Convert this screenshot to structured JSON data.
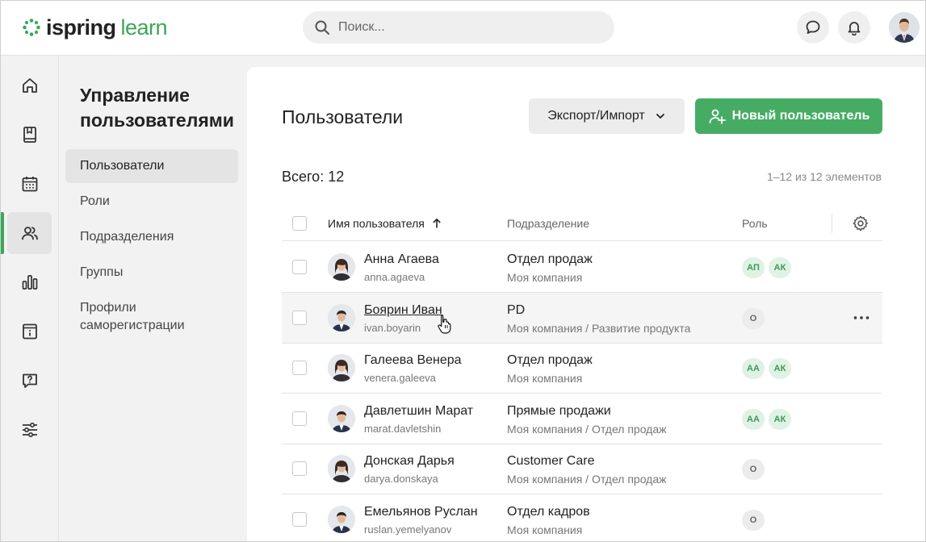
{
  "header": {
    "logo_part1": "ispring",
    "logo_part2": "learn",
    "search_placeholder": "Поиск...",
    "brand_color": "#3aa757"
  },
  "rail": {
    "items": [
      {
        "icon": "home-icon"
      },
      {
        "icon": "book-icon"
      },
      {
        "icon": "calendar-icon"
      },
      {
        "icon": "users-icon",
        "active": true
      },
      {
        "icon": "bar-chart-icon"
      },
      {
        "icon": "info-page-icon"
      },
      {
        "icon": "question-chat-icon"
      },
      {
        "icon": "sliders-icon"
      }
    ]
  },
  "sidebar": {
    "title": "Управление пользователями",
    "items": [
      {
        "label": "Пользователи",
        "active": true
      },
      {
        "label": "Роли"
      },
      {
        "label": "Подразделения"
      },
      {
        "label": "Группы"
      },
      {
        "label": "Профили саморегистрации"
      }
    ]
  },
  "main": {
    "title": "Пользователи",
    "export_label": "Экспорт/Импорт",
    "new_user_label": "Новый пользователь",
    "total": "Всего: 12",
    "range": "1–12 из 12 элементов",
    "columns": {
      "name": "Имя пользователя",
      "dept": "Подразделение",
      "role": "Роль"
    },
    "rows": [
      {
        "name": "Анна Агаева",
        "login": "anna.agaeva",
        "dept": "Отдел продаж",
        "path": "Моя компания",
        "roles": [
          {
            "t": "АП",
            "c": "green"
          },
          {
            "t": "АК",
            "c": "green"
          }
        ],
        "gender": "f"
      },
      {
        "name": "Боярин Иван",
        "login": "ivan.boyarin",
        "dept": "PD",
        "path": "Моя компания / Развитие продукта",
        "roles": [
          {
            "t": "О",
            "c": "grey"
          }
        ],
        "gender": "m",
        "hover": true
      },
      {
        "name": "Галеева Венера",
        "login": "venera.galeeva",
        "dept": "Отдел продаж",
        "path": "Моя компания",
        "roles": [
          {
            "t": "АА",
            "c": "green"
          },
          {
            "t": "АК",
            "c": "green"
          }
        ],
        "gender": "f"
      },
      {
        "name": "Давлетшин Марат",
        "login": "marat.davletshin",
        "dept": "Прямые продажи",
        "path": "Моя компания / Отдел продаж",
        "roles": [
          {
            "t": "АА",
            "c": "green"
          },
          {
            "t": "АК",
            "c": "green"
          }
        ],
        "gender": "m"
      },
      {
        "name": "Донская Дарья",
        "login": "darya.donskaya",
        "dept": "Customer Care",
        "path": "Моя компания / Отдел продаж",
        "roles": [
          {
            "t": "О",
            "c": "grey"
          }
        ],
        "gender": "f"
      },
      {
        "name": "Емельянов Руслан",
        "login": "ruslan.yemelyanov",
        "dept": "Отдел кадров",
        "path": "Моя компания",
        "roles": [
          {
            "t": "О",
            "c": "grey"
          }
        ],
        "gender": "m"
      }
    ]
  }
}
